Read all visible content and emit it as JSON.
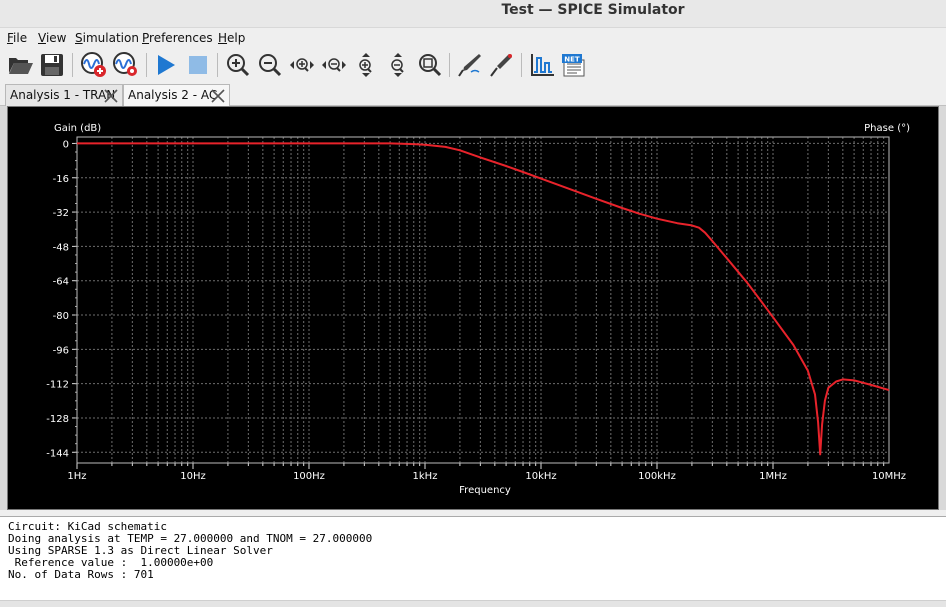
{
  "window": {
    "title": "Test — SPICE Simulator"
  },
  "menu": [
    {
      "label": "File",
      "ul": "F",
      "rest": "ile"
    },
    {
      "label": "View",
      "ul": "V",
      "rest": "iew"
    },
    {
      "label": "Simulation",
      "ul": "S",
      "rest": "imulation"
    },
    {
      "label": "Preferences",
      "ul": "P",
      "rest": "references"
    },
    {
      "label": "Help",
      "ul": "H",
      "rest": "elp"
    }
  ],
  "toolbar": {
    "icons": [
      "open-folder-icon",
      "save-icon",
      "add-signals-icon",
      "probe-settings-icon",
      "run-simulation-icon",
      "stop-simulation-icon",
      "zoom-in-icon",
      "zoom-out-icon",
      "zoom-in-horizontal-icon",
      "zoom-out-horizontal-icon",
      "zoom-in-vertical-icon",
      "zoom-out-vertical-icon",
      "zoom-fit-icon",
      "probe-icon",
      "tune-icon",
      "plot-settings-icon",
      "netlist-icon"
    ],
    "netlist_badge": "NET"
  },
  "tabs": [
    {
      "label": "Analysis 1 - TRAN",
      "active": false
    },
    {
      "label": "Analysis 2 - AC",
      "active": true
    }
  ],
  "chart_data": {
    "type": "line",
    "xscale": "log",
    "xlabel": "Frequency",
    "ylabel": "Gain (dB)",
    "y2label": "Phase (°)",
    "x_ticks": [
      "1Hz",
      "10Hz",
      "100Hz",
      "1kHz",
      "10kHz",
      "100kHz",
      "1MHz",
      "10MHz"
    ],
    "y_ticks": [
      "0",
      "-16",
      "-32",
      "-48",
      "-64",
      "-80",
      "-96",
      "-112",
      "-128",
      "-144"
    ],
    "xlim": [
      1,
      10000000
    ],
    "ylim": [
      -149,
      3
    ],
    "grid": true,
    "colors": {
      "background": "#000000",
      "grid": "#6e6e6e",
      "trace": "#e8232b",
      "text": "#ffffff"
    },
    "series": [
      {
        "x": [
          1,
          10,
          100,
          500,
          800,
          1000,
          1500,
          2000,
          3000,
          5000,
          7000,
          10000,
          20000,
          30000,
          50000,
          70000,
          100000,
          150000,
          200000,
          230000,
          260000,
          300000,
          400000,
          600000,
          800000,
          1000000,
          1500000,
          2000000,
          2300000,
          2450000,
          2550000,
          2650000,
          2800000,
          3000000,
          3500000,
          4000000,
          5000000,
          6000000,
          7000000,
          10000000
        ],
        "y": [
          0,
          0,
          0,
          0,
          -0.3,
          -0.6,
          -1.6,
          -3.2,
          -6.5,
          -10.5,
          -13.3,
          -16.4,
          -22.3,
          -25.8,
          -30.1,
          -32.7,
          -35.1,
          -37.2,
          -38.2,
          -39.3,
          -41.6,
          -45.5,
          -53.5,
          -65,
          -74,
          -81,
          -94,
          -106,
          -117,
          -130,
          -145,
          -131,
          -120,
          -114,
          -111,
          -110,
          -110.5,
          -111.6,
          -112.6,
          -115
        ]
      }
    ]
  },
  "console": {
    "lines": [
      "Circuit: KiCad schematic",
      "Doing analysis at TEMP = 27.000000 and TNOM = 27.000000",
      "Using SPARSE 1.3 as Direct Linear Solver",
      " Reference value :  1.00000e+00",
      "No. of Data Rows : 701"
    ]
  }
}
